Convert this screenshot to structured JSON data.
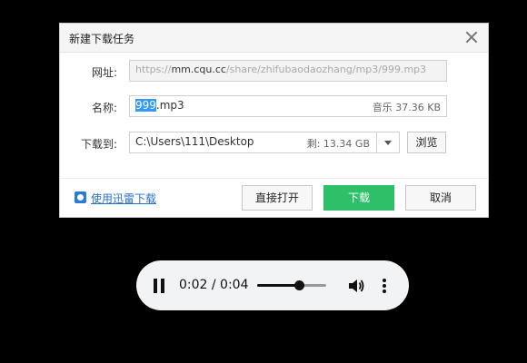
{
  "dialog": {
    "title": "新建下载任务",
    "url_label": "网址:",
    "url_prefix": "https://",
    "url_host": "mm.cqu.cc",
    "url_path": "/share/zhifubaodaozhang/mp3/999.mp3",
    "name_label": "名称:",
    "name_selected": "999",
    "name_rest": ".mp3",
    "name_meta": "音乐 37.36 KB",
    "path_label": "下载到:",
    "path_value": "C:\\Users\\111\\Desktop",
    "free_space": "剩: 13.34 GB",
    "browse_label": "浏览",
    "xunlei_link": "使用迅雷下载",
    "open_label": "直接打开",
    "download_label": "下载",
    "cancel_label": "取消"
  },
  "player": {
    "time": "0:02 / 0:04",
    "progress_fraction": 0.6
  }
}
